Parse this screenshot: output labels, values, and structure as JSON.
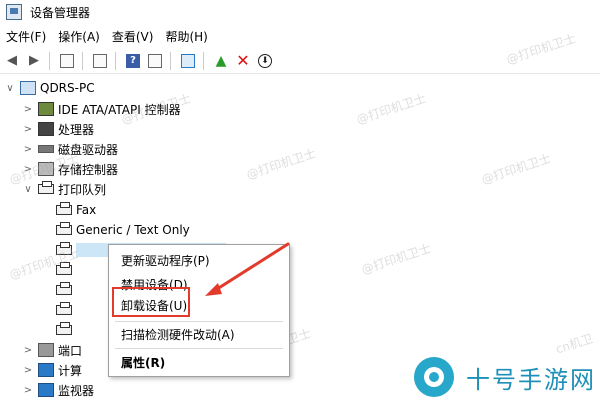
{
  "window": {
    "title": "设备管理器"
  },
  "menu": [
    "文件(F)",
    "操作(A)",
    "查看(V)",
    "帮助(H)"
  ],
  "tree": {
    "root": "QDRS-PC",
    "categories": [
      {
        "label": "IDE ATA/ATAPI 控制器",
        "icon": "ide-icon"
      },
      {
        "label": "处理器",
        "icon": "processor-icon"
      },
      {
        "label": "磁盘驱动器",
        "icon": "disk-icon"
      },
      {
        "label": "存储控制器",
        "icon": "storage-icon"
      },
      {
        "label": "打印队列",
        "icon": "printer-icon"
      }
    ],
    "printers": [
      "Fax",
      "Generic / Text Only"
    ],
    "partial": [
      "端口",
      "计算",
      "监视器"
    ]
  },
  "context_menu": {
    "items": [
      "更新驱动程序(P)",
      "禁用设备(D)",
      "卸载设备(U)",
      "扫描检测硬件改动(A)",
      "属性(R)"
    ]
  },
  "watermark": {
    "text": "@打印机卫士",
    "text_cn": "cn机卫"
  },
  "branding": {
    "name": "十号手游网"
  },
  "colors": {
    "highlight": "#e23a2b",
    "brand": "#1e90b8"
  }
}
